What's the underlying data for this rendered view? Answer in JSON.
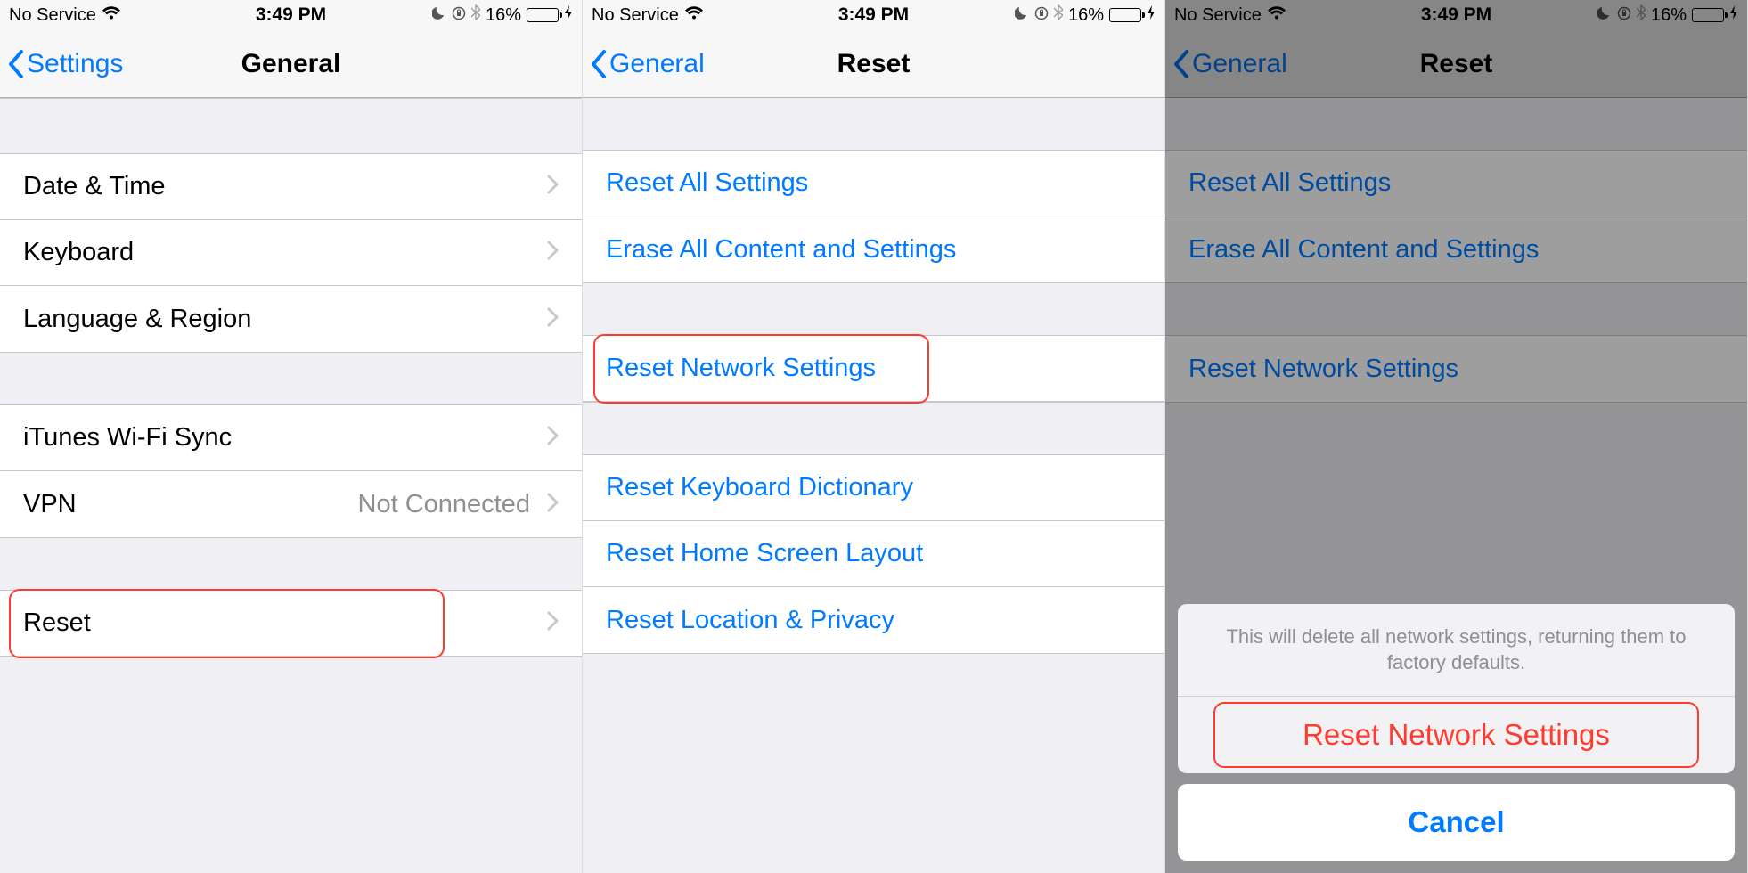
{
  "status": {
    "carrier": "No Service",
    "time": "3:49 PM",
    "battery_pct": "16%"
  },
  "screen1": {
    "back": "Settings",
    "title": "General",
    "rows": {
      "date_time": "Date & Time",
      "keyboard": "Keyboard",
      "language_region": "Language & Region",
      "itunes_wifi": "iTunes Wi-Fi Sync",
      "vpn": "VPN",
      "vpn_value": "Not Connected",
      "reset": "Reset"
    }
  },
  "screen2": {
    "back": "General",
    "title": "Reset",
    "rows": {
      "reset_all": "Reset All Settings",
      "erase_all": "Erase All Content and Settings",
      "reset_network": "Reset Network Settings",
      "reset_keyboard": "Reset Keyboard Dictionary",
      "reset_home": "Reset Home Screen Layout",
      "reset_location": "Reset Location & Privacy"
    }
  },
  "screen3": {
    "back": "General",
    "title": "Reset",
    "rows": {
      "reset_all": "Reset All Settings",
      "erase_all": "Erase All Content and Settings",
      "reset_network": "Reset Network Settings"
    },
    "sheet": {
      "message": "This will delete all network settings, returning them to factory defaults.",
      "confirm": "Reset Network Settings",
      "cancel": "Cancel"
    }
  }
}
